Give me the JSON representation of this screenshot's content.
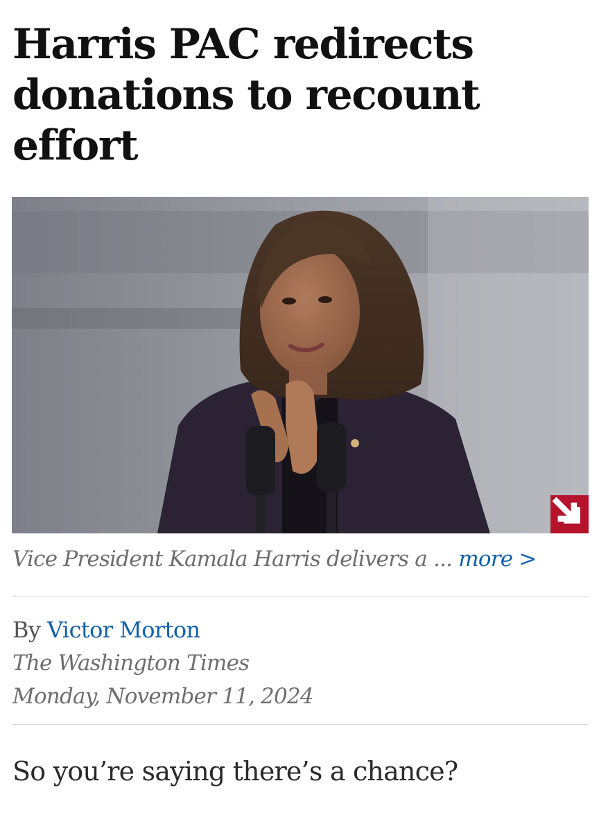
{
  "article": {
    "headline": "Harris PAC redirects donations to recount effort",
    "image": {
      "alt": "Vice President Kamala Harris at microphones",
      "expand_icon": "expand-arrow-icon"
    },
    "caption": {
      "text": "Vice President Kamala Harris delivers a ...",
      "more_label": "more >"
    },
    "byline": {
      "prefix": "By",
      "author": "Victor Morton"
    },
    "publication": "The Washington Times",
    "date": "Monday, November 11, 2024",
    "lede": "So you’re saying there’s a chance?"
  },
  "colors": {
    "link": "#1360a8",
    "accent_red": "#b5122b"
  }
}
